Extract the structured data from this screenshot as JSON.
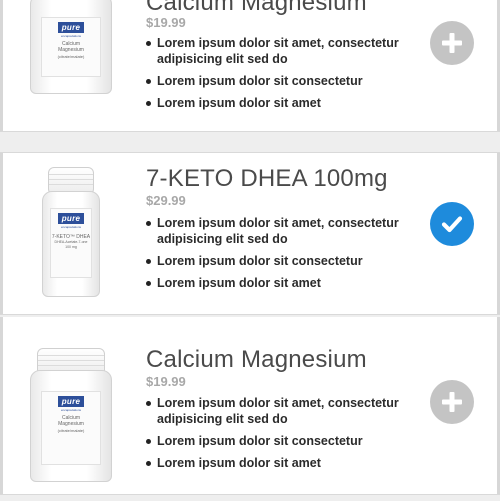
{
  "products": [
    {
      "name": "Calcium Magnesium",
      "price": "$19.99",
      "selected": false,
      "action_icon": "add-circle-icon",
      "features": [
        "Lorem ipsum dolor sit amet, consectetur adipisicing elit sed do",
        "Lorem ipsum dolor sit consectetur",
        "Lorem ipsum dolor sit amet"
      ],
      "bottle": {
        "brand": "pure",
        "brand_sub": "encapsulations",
        "lines": [
          "Calcium",
          "Magnesium",
          "(citrate/malate)"
        ]
      }
    },
    {
      "name": "7-KETO DHEA 100mg",
      "price": "$29.99",
      "selected": true,
      "action_icon": "check-circle-icon",
      "features": [
        "Lorem ipsum dolor sit amet, consectetur adipisicing elit sed do",
        "Lorem ipsum dolor sit consectetur",
        "Lorem ipsum dolor sit amet"
      ],
      "bottle": {
        "brand": "pure",
        "brand_sub": "encapsulations",
        "lines": [
          "7-KETO™ DHEA",
          "DHEA-Acetate-7-one",
          "100 mg"
        ]
      }
    },
    {
      "name": "Calcium Magnesium",
      "price": "$19.99",
      "selected": false,
      "action_icon": "add-circle-icon",
      "features": [
        "Lorem ipsum dolor sit amet, consectetur adipisicing elit sed do",
        "Lorem ipsum dolor sit consectetur",
        "Lorem ipsum dolor sit amet"
      ],
      "bottle": {
        "brand": "pure",
        "brand_sub": "encapsulations",
        "lines": [
          "Calcium",
          "Magnesium",
          "(citrate/malate)"
        ]
      }
    }
  ],
  "colors": {
    "add_icon": "#c4c4c4",
    "selected_icon": "#1e8bdc",
    "price": "#a8a8a8",
    "title": "#4a4a4a"
  }
}
